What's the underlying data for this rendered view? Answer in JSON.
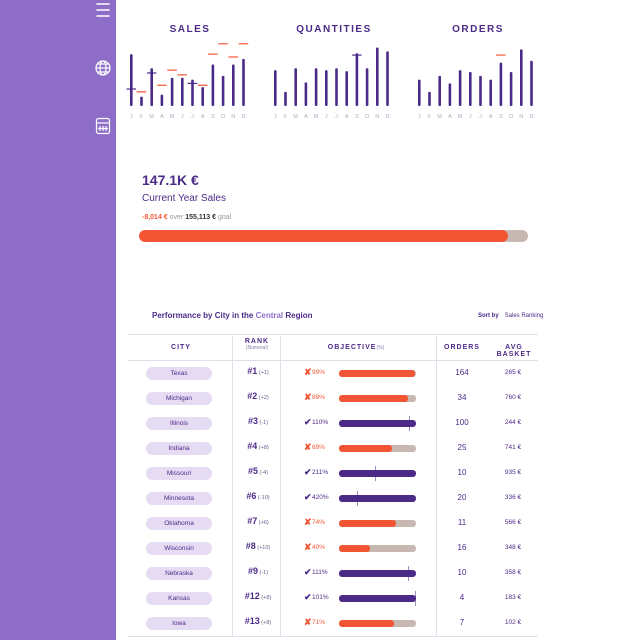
{
  "sidebar": {
    "icons": [
      "menu-icon",
      "globe-icon",
      "calendar-icon"
    ],
    "bg_color": "#8e6dc8"
  },
  "colors": {
    "accent": "#4b2a88",
    "negative": "#f25533",
    "track": "#c8b8b2",
    "pill": "#e5dcf4"
  },
  "chart_data": [
    {
      "type": "bar",
      "title": "SALES",
      "categories": [
        "J",
        "F",
        "M",
        "A",
        "M",
        "J",
        "J",
        "A",
        "S",
        "O",
        "N",
        "D"
      ],
      "values": [
        55,
        10,
        40,
        12,
        30,
        30,
        28,
        20,
        44,
        32,
        44,
        50
      ],
      "previous_year_markers": [
        18,
        15,
        35,
        22,
        38,
        33,
        24,
        22,
        55,
        66,
        52,
        66
      ],
      "ylim": [
        0,
        70
      ]
    },
    {
      "type": "bar",
      "title": "QUANTITIES",
      "categories": [
        "J",
        "F",
        "M",
        "A",
        "M",
        "J",
        "J",
        "A",
        "S",
        "O",
        "N",
        "D"
      ],
      "values": [
        38,
        15,
        40,
        25,
        40,
        38,
        40,
        37,
        56,
        40,
        62,
        58
      ],
      "previous_year_markers": [
        null,
        null,
        null,
        null,
        null,
        null,
        null,
        null,
        54,
        null,
        null,
        null
      ],
      "ylim": [
        0,
        70
      ]
    },
    {
      "type": "bar",
      "title": "ORDERS",
      "categories": [
        "J",
        "F",
        "M",
        "A",
        "M",
        "J",
        "J",
        "A",
        "S",
        "O",
        "N",
        "D"
      ],
      "values": [
        28,
        15,
        32,
        24,
        38,
        36,
        32,
        28,
        46,
        36,
        60,
        48
      ],
      "previous_year_markers": [
        null,
        null,
        null,
        null,
        null,
        null,
        null,
        null,
        54,
        null,
        null,
        null
      ],
      "ylim": [
        0,
        70
      ]
    },
    {
      "type": "table",
      "title": "Performance by City in the Central Region",
      "columns": [
        "CITY",
        "RANK",
        "OBJECTIVE",
        "ORDERS",
        "AVG BASKET"
      ],
      "rows": [
        {
          "city": "Texas",
          "rank": "#1",
          "change": "(+1)",
          "ok": false,
          "objective_pct": "99%",
          "objective_fill": 0.99,
          "orders": "164",
          "basket": "265 €"
        },
        {
          "city": "Michigan",
          "rank": "#2",
          "change": "(+2)",
          "ok": false,
          "objective_pct": "89%",
          "objective_fill": 0.89,
          "orders": "34",
          "basket": "760 €"
        },
        {
          "city": "Illinois",
          "rank": "#3",
          "change": "(-1)",
          "ok": true,
          "objective_pct": "110%",
          "objective_fill": 1.0,
          "marker": 0.91,
          "orders": "100",
          "basket": "244 €"
        },
        {
          "city": "Indiana",
          "rank": "#4",
          "change": "(+8)",
          "ok": false,
          "objective_pct": "69%",
          "objective_fill": 0.69,
          "orders": "25",
          "basket": "741 €"
        },
        {
          "city": "Missouri",
          "rank": "#5",
          "change": "(-4)",
          "ok": true,
          "objective_pct": "211%",
          "objective_fill": 1.0,
          "marker": 0.47,
          "orders": "10",
          "basket": "935 €"
        },
        {
          "city": "Minnesota",
          "rank": "#6",
          "change": "(-10)",
          "ok": true,
          "objective_pct": "420%",
          "objective_fill": 1.0,
          "marker": 0.24,
          "orders": "20",
          "basket": "336 €"
        },
        {
          "city": "Oklahoma",
          "rank": "#7",
          "change": "(+6)",
          "ok": false,
          "objective_pct": "74%",
          "objective_fill": 0.74,
          "orders": "11",
          "basket": "566 €"
        },
        {
          "city": "Wisconsin",
          "rank": "#8",
          "change": "(+10)",
          "ok": false,
          "objective_pct": "40%",
          "objective_fill": 0.4,
          "orders": "16",
          "basket": "348 €"
        },
        {
          "city": "Nebraska",
          "rank": "#9",
          "change": "(-1)",
          "ok": true,
          "objective_pct": "111%",
          "objective_fill": 1.0,
          "marker": 0.9,
          "orders": "10",
          "basket": "358 €"
        },
        {
          "city": "Kansas",
          "rank": "#12",
          "change": "(+8)",
          "ok": true,
          "objective_pct": "101%",
          "objective_fill": 1.0,
          "marker": 0.99,
          "orders": "4",
          "basket": "183 €"
        },
        {
          "city": "Iowa",
          "rank": "#13",
          "change": "(+8)",
          "ok": false,
          "objective_pct": "71%",
          "objective_fill": 0.71,
          "orders": "7",
          "basket": "102 €"
        }
      ]
    }
  ],
  "kpi": {
    "value": "147.1K €",
    "label": "Current Year Sales",
    "delta": "-8,014 €",
    "over": "over",
    "goal": "155,113 €",
    "goal_word": "goal",
    "progress": 0.948
  },
  "performance": {
    "title_prefix": "Performance by City in the ",
    "region": "Central",
    "title_suffix": " Region",
    "sort_label": "Sort by",
    "sort_value": "Sales Ranking",
    "headers": {
      "city": "CITY",
      "rank": "RANK",
      "rank_sub": "(Numeral)",
      "objective": "OBJECTIVE",
      "objective_unit": "(%)",
      "orders": "ORDERS",
      "basket": "AVG BASKET"
    }
  }
}
